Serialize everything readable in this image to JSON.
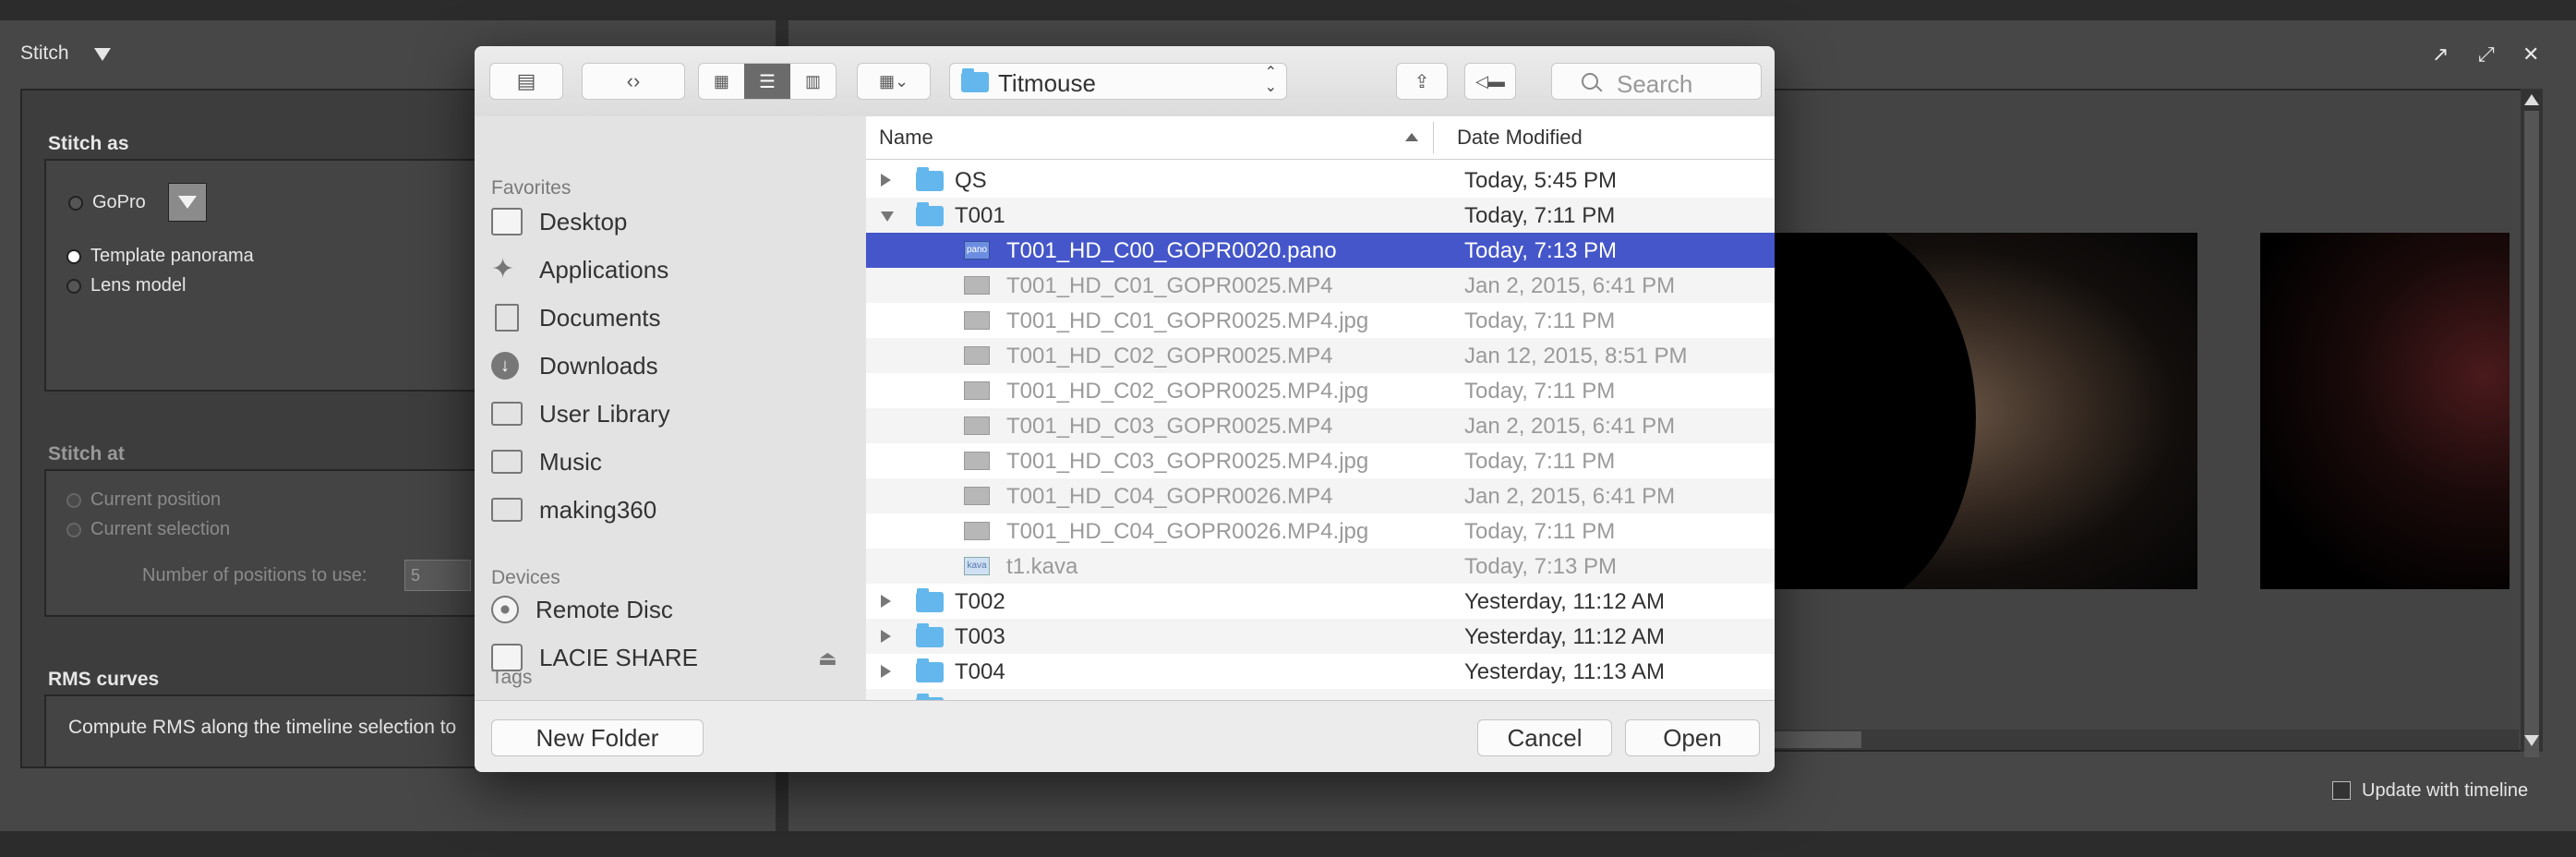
{
  "app": {
    "stitch_menu_label": "Stitch",
    "stitch_as": {
      "title": "Stitch as",
      "gopro_label": "GoPro",
      "template_label": "Template panorama",
      "lens_label": "Lens model"
    },
    "stitch_at": {
      "title": "Stitch at",
      "current_position_label": "Current position",
      "current_selection_label": "Current selection",
      "positions_label": "Number of positions to use:",
      "positions_value": "5"
    },
    "rms": {
      "title": "RMS curves",
      "text": "Compute RMS along the timeline selection to"
    },
    "update_with_timeline_label": "Update with timeline"
  },
  "dialog": {
    "location": "Titmouse",
    "search_placeholder": "Search",
    "sidebar": {
      "favorites_header": "Favorites",
      "favorites": [
        {
          "label": "Desktop",
          "icon": "desktop-icon"
        },
        {
          "label": "Applications",
          "icon": "applications-icon"
        },
        {
          "label": "Documents",
          "icon": "documents-icon"
        },
        {
          "label": "Downloads",
          "icon": "downloads-icon"
        },
        {
          "label": "User Library",
          "icon": "folder-icon"
        },
        {
          "label": "Music",
          "icon": "folder-icon"
        },
        {
          "label": "making360",
          "icon": "folder-icon"
        }
      ],
      "devices_header": "Devices",
      "devices": [
        {
          "label": "Remote Disc",
          "icon": "disc-icon"
        },
        {
          "label": "LACIE SHARE",
          "icon": "drive-icon"
        }
      ],
      "tags_header": "Tags"
    },
    "columns": {
      "name": "Name",
      "date": "Date Modified"
    },
    "rows": [
      {
        "name": "QS",
        "date": "Today, 5:45 PM"
      },
      {
        "name": "T001",
        "date": "Today, 7:11 PM"
      },
      {
        "name": "T001_HD_C00_GOPR0020.pano",
        "date": "Today, 7:13 PM"
      },
      {
        "name": "T001_HD_C01_GOPR0025.MP4",
        "date": "Jan 2, 2015, 6:41 PM"
      },
      {
        "name": "T001_HD_C01_GOPR0025.MP4.jpg",
        "date": "Today, 7:11 PM"
      },
      {
        "name": "T001_HD_C02_GOPR0025.MP4",
        "date": "Jan 12, 2015, 8:51 PM"
      },
      {
        "name": "T001_HD_C02_GOPR0025.MP4.jpg",
        "date": "Today, 7:11 PM"
      },
      {
        "name": "T001_HD_C03_GOPR0025.MP4",
        "date": "Jan 2, 2015, 6:41 PM"
      },
      {
        "name": "T001_HD_C03_GOPR0025.MP4.jpg",
        "date": "Today, 7:11 PM"
      },
      {
        "name": "T001_HD_C04_GOPR0026.MP4",
        "date": "Jan 2, 2015, 6:41 PM"
      },
      {
        "name": "T001_HD_C04_GOPR0026.MP4.jpg",
        "date": "Today, 7:11 PM"
      },
      {
        "name": "t1.kava",
        "date": "Today, 7:13 PM"
      },
      {
        "name": "T002",
        "date": "Yesterday, 11:12 AM"
      },
      {
        "name": "T003",
        "date": "Yesterday, 11:12 AM"
      },
      {
        "name": "T004",
        "date": "Yesterday, 11:13 AM"
      }
    ],
    "buttons": {
      "new_folder": "New Folder",
      "cancel": "Cancel",
      "open": "Open"
    }
  },
  "colors": {
    "selection": "#4456c9",
    "folder": "#63b7ec"
  }
}
